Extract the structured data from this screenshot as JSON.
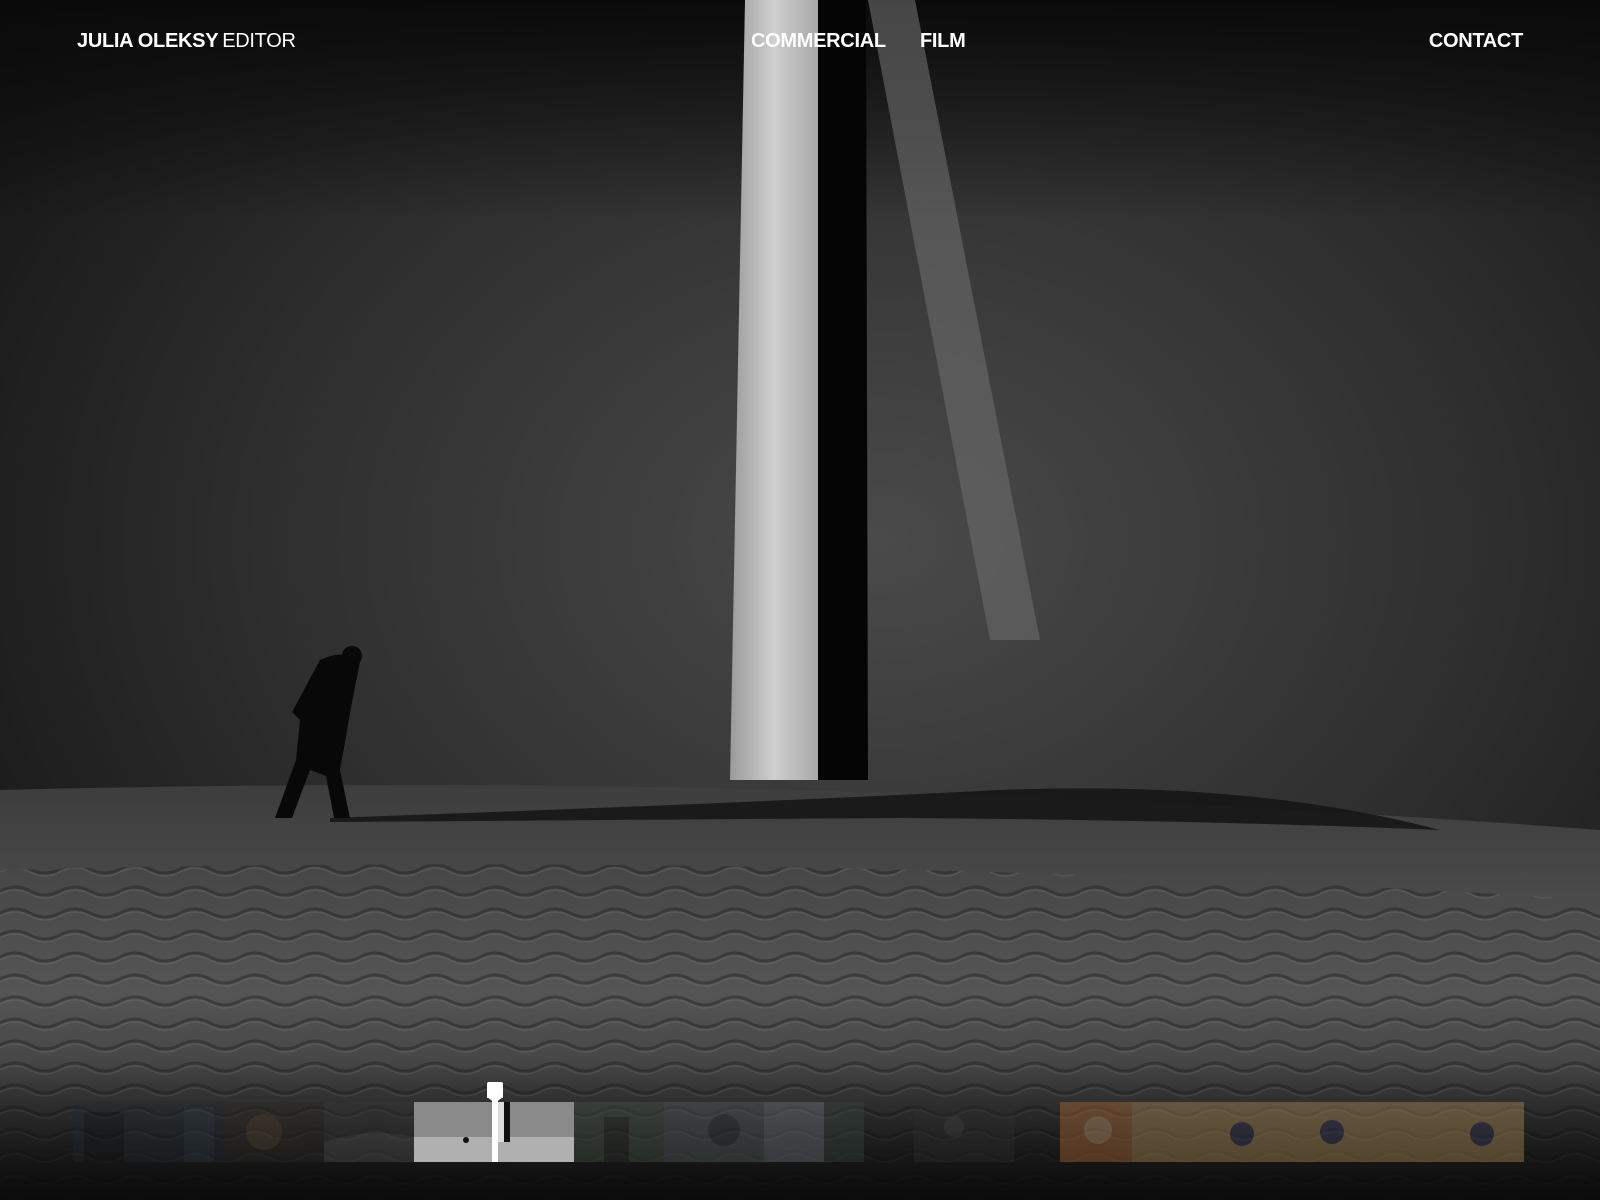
{
  "brand": {
    "name": "JULIA OLEKSY",
    "role": "EDITOR"
  },
  "nav": {
    "commercial": "COMMERCIAL",
    "film": "FILM",
    "contact": "CONTACT"
  },
  "timeline": {
    "thumbnails": [
      {
        "id": "clip-1",
        "tone": "#1f2a33"
      },
      {
        "id": "clip-2",
        "tone": "#3a3a3a"
      },
      {
        "id": "clip-3",
        "tone": "#c8c8c8",
        "active": true
      },
      {
        "id": "clip-4",
        "tone": "#5a6a5a"
      },
      {
        "id": "clip-5",
        "tone": "#5e666a"
      },
      {
        "id": "clip-6",
        "tone": "#3a3a3a"
      },
      {
        "id": "clip-7",
        "tone": "#c9783a"
      },
      {
        "id": "clip-8",
        "tone": "#caa060"
      }
    ]
  },
  "colors": {
    "accent": "#ffffff",
    "background": "#0b0b0b"
  }
}
